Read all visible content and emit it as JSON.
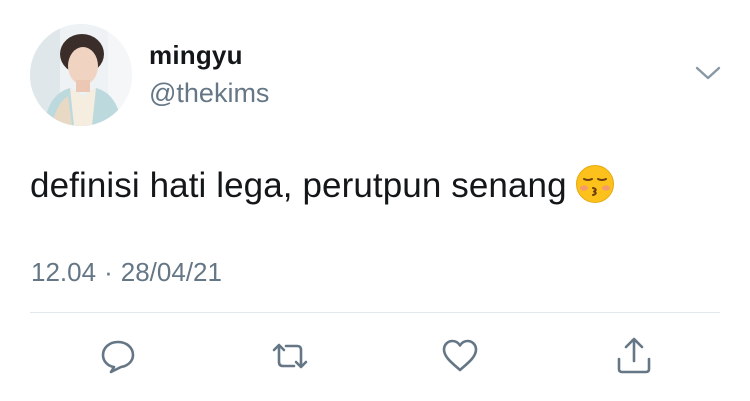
{
  "tweet": {
    "author": {
      "display_name": "mingyu",
      "handle": "@thekims",
      "avatar_icon": "profile-photo"
    },
    "text": "definisi hati lega, perutpun senang",
    "emoji_icon": "kissing-closed-eyes-emoji",
    "time": "12.04",
    "separator": "·",
    "date": "28/04/21"
  },
  "actions": [
    {
      "icon": "reply-icon"
    },
    {
      "icon": "retweet-icon"
    },
    {
      "icon": "like-icon"
    },
    {
      "icon": "share-icon"
    }
  ],
  "colors": {
    "text": "#14171a",
    "secondary": "#657786",
    "divider": "#e1e8ed"
  }
}
